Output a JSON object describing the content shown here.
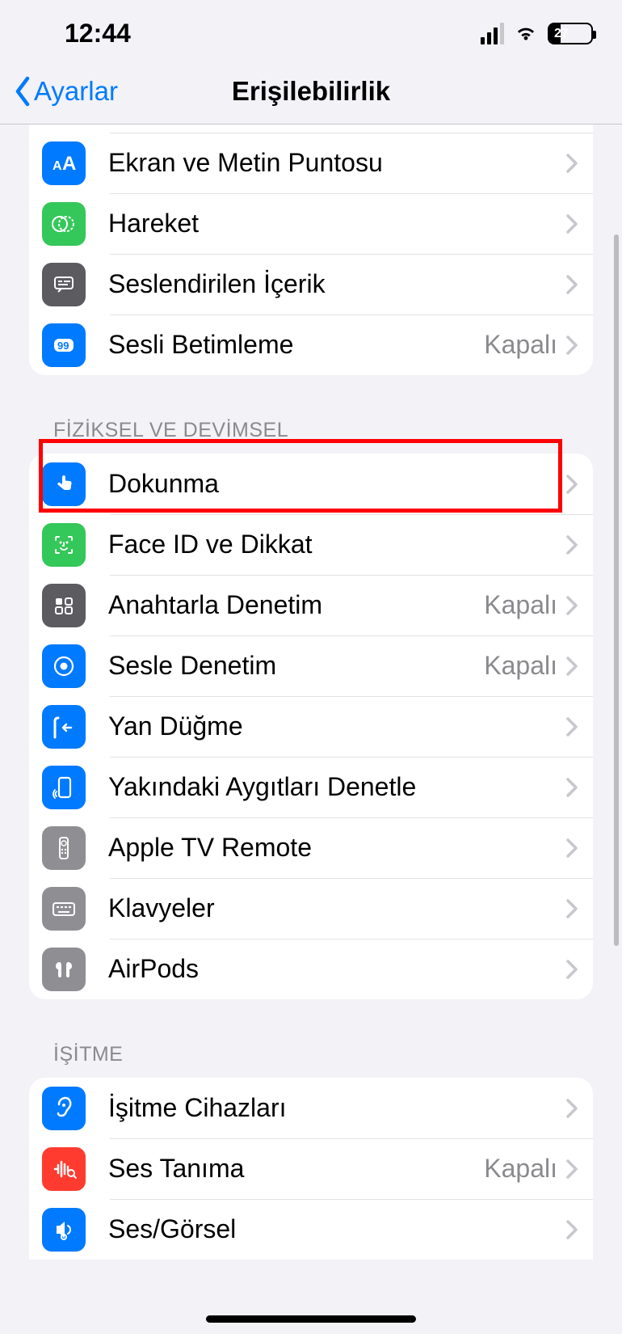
{
  "statusbar": {
    "time": "12:44",
    "battery_pct": "27"
  },
  "nav": {
    "back_label": "Ayarlar",
    "title": "Erişilebilirlik"
  },
  "section_vision": {
    "items": [
      {
        "label": "Ekran ve Metin Puntosu",
        "value": "",
        "icon": "text-size-icon",
        "bg": "bg-blue"
      },
      {
        "label": "Hareket",
        "value": "",
        "icon": "motion-icon",
        "bg": "bg-green"
      },
      {
        "label": "Seslendirilen İçerik",
        "value": "",
        "icon": "spoken-content-icon",
        "bg": "bg-gray"
      },
      {
        "label": "Sesli Betimleme",
        "value": "Kapalı",
        "icon": "audio-description-icon",
        "bg": "bg-blue"
      }
    ]
  },
  "section_physical": {
    "header": "FİZİKSEL VE DEVİMSEL",
    "items": [
      {
        "label": "Dokunma",
        "value": "",
        "icon": "touch-icon",
        "bg": "bg-blue"
      },
      {
        "label": "Face ID ve Dikkat",
        "value": "",
        "icon": "face-id-icon",
        "bg": "bg-green"
      },
      {
        "label": "Anahtarla Denetim",
        "value": "Kapalı",
        "icon": "switch-control-icon",
        "bg": "bg-gray"
      },
      {
        "label": "Sesle Denetim",
        "value": "Kapalı",
        "icon": "voice-control-icon",
        "bg": "bg-blue"
      },
      {
        "label": "Yan Düğme",
        "value": "",
        "icon": "side-button-icon",
        "bg": "bg-blue"
      },
      {
        "label": "Yakındaki Aygıtları Denetle",
        "value": "",
        "icon": "nearby-devices-icon",
        "bg": "bg-blue"
      },
      {
        "label": "Apple TV Remote",
        "value": "",
        "icon": "apple-tv-remote-icon",
        "bg": "bg-lgray"
      },
      {
        "label": "Klavyeler",
        "value": "",
        "icon": "keyboard-icon",
        "bg": "bg-lgray"
      },
      {
        "label": "AirPods",
        "value": "",
        "icon": "airpods-icon",
        "bg": "bg-lgray"
      }
    ]
  },
  "section_hearing": {
    "header": "İŞİTME",
    "items": [
      {
        "label": "İşitme Cihazları",
        "value": "",
        "icon": "hearing-devices-icon",
        "bg": "bg-blue"
      },
      {
        "label": "Ses Tanıma",
        "value": "Kapalı",
        "icon": "sound-recognition-icon",
        "bg": "bg-red"
      },
      {
        "label": "Ses/Görsel",
        "value": "",
        "icon": "audio-visual-icon",
        "bg": "bg-blue"
      }
    ]
  }
}
